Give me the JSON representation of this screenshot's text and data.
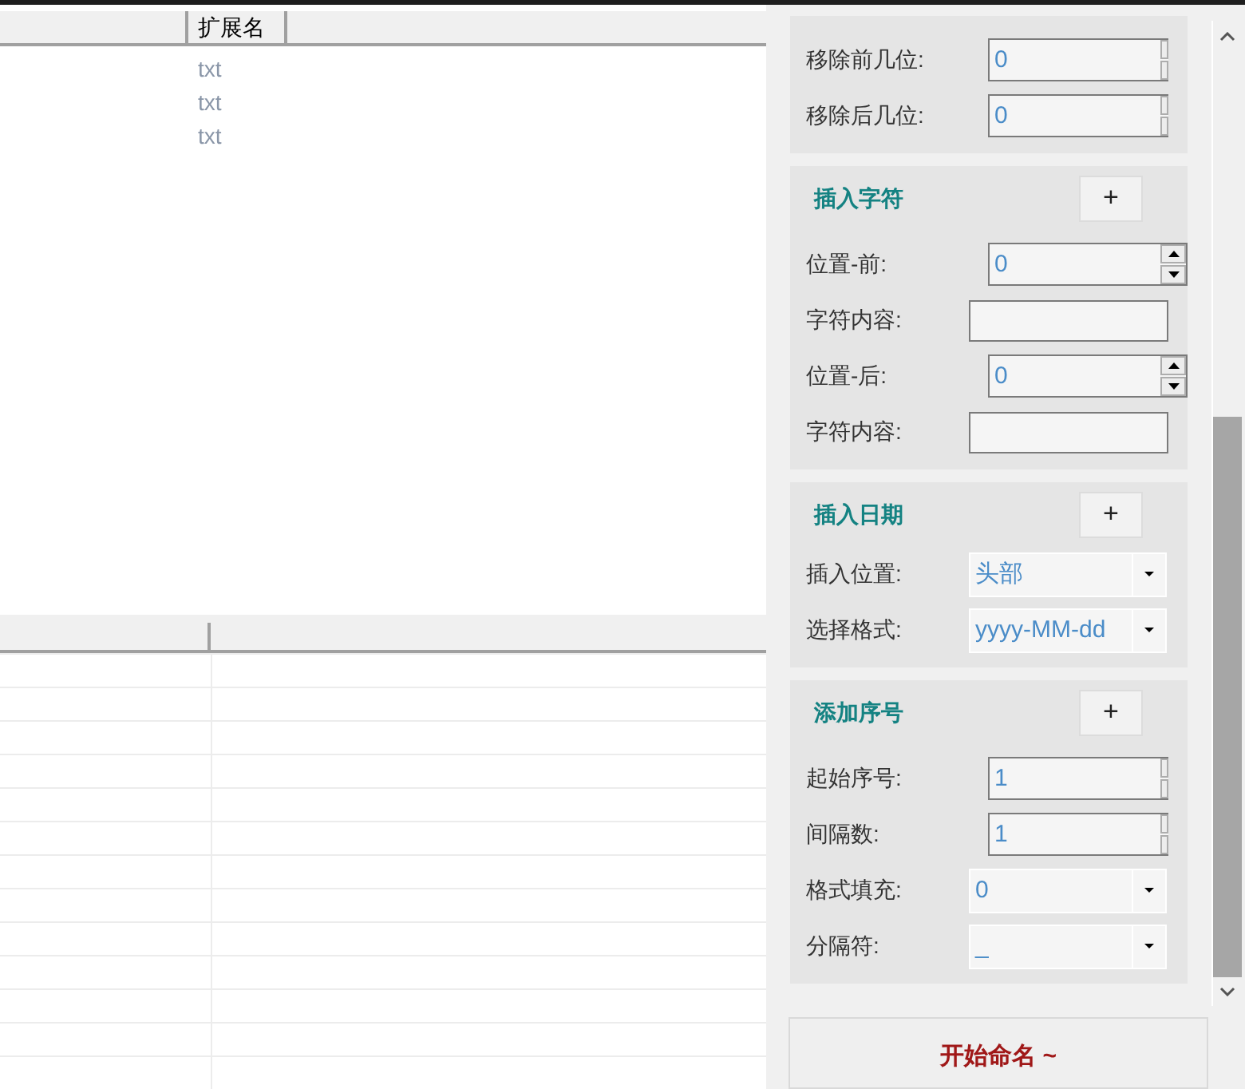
{
  "file_table": {
    "columns": [
      {},
      {
        "label": "扩展名"
      }
    ],
    "rows": [
      {
        "extension": "txt"
      },
      {
        "extension": "txt"
      },
      {
        "extension": "txt"
      }
    ]
  },
  "sections": [
    {
      "fields": [
        {
          "kind": "clippedspinner",
          "label": "移除前几位:",
          "value": "0"
        },
        {
          "kind": "clippedspinner",
          "label": "移除后几位:",
          "value": "0"
        }
      ]
    },
    {
      "title": "插入字符",
      "add_button": "+",
      "fields": [
        {
          "kind": "spinner",
          "label": "位置-前:",
          "value": "0"
        },
        {
          "kind": "text",
          "label": "字符内容:"
        },
        {
          "kind": "spinner",
          "label": "位置-后:",
          "value": "0"
        },
        {
          "kind": "text",
          "label": "字符内容:"
        }
      ]
    },
    {
      "title": "插入日期",
      "add_button": "+",
      "fields": [
        {
          "kind": "dropdown",
          "label": "插入位置:",
          "value": "头部"
        },
        {
          "kind": "dropdown",
          "label": "选择格式:",
          "value": "yyyy-MM-dd"
        }
      ]
    },
    {
      "title": "添加序号",
      "add_button": "+",
      "fields": [
        {
          "kind": "clippedspinner",
          "label": "起始序号:",
          "value": "1"
        },
        {
          "kind": "clippedspinner",
          "label": "间隔数:",
          "value": "1"
        },
        {
          "kind": "dropdown",
          "label": "格式填充:",
          "value": "0"
        },
        {
          "kind": "dropdown",
          "label": "分隔符:",
          "value": "_"
        }
      ]
    }
  ],
  "start_button": "开始命名 ~"
}
